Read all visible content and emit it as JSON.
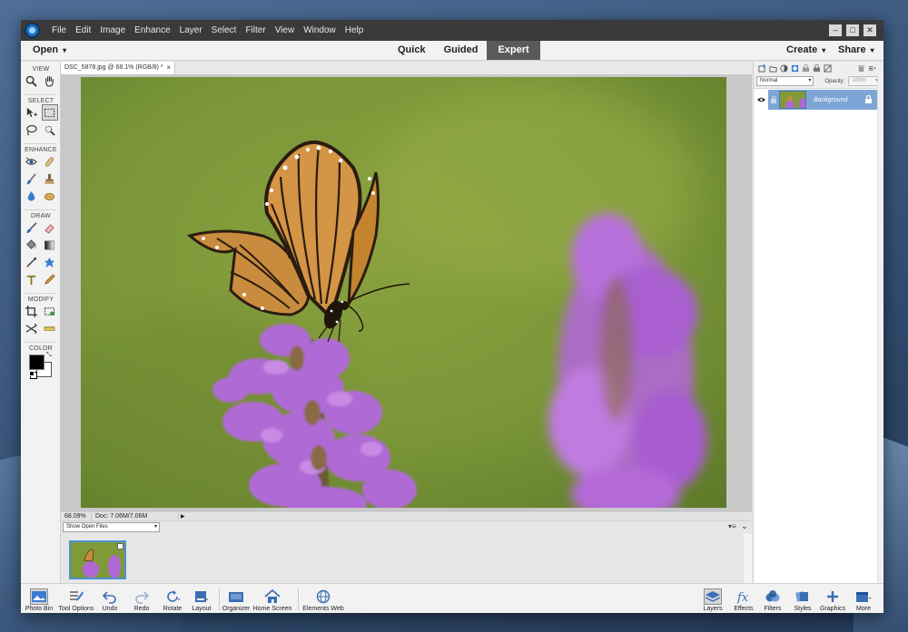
{
  "menubar": {
    "items": [
      "File",
      "Edit",
      "Image",
      "Enhance",
      "Layer",
      "Select",
      "Filter",
      "View",
      "Window",
      "Help"
    ],
    "window_controls": [
      "–",
      "□",
      "✕"
    ]
  },
  "modebar": {
    "open": "Open",
    "tabs": [
      "Quick",
      "Guided",
      "Expert"
    ],
    "active_tab": "Expert",
    "create": "Create",
    "share": "Share"
  },
  "toolbox": {
    "sections": {
      "view": "VIEW",
      "select": "SELECT",
      "enhance": "ENHANCE",
      "draw": "DRAW",
      "modify": "MODIFY",
      "color": "COLOR"
    },
    "foreground_color": "#000000",
    "background_color": "#ffffff"
  },
  "document": {
    "tab_title": "DSC_5878.jpg @ 68.1% (RGB/8) *",
    "close": "×",
    "zoom": "68.09%",
    "doc_info": "Doc: 7.06M/7.06M"
  },
  "layers_panel": {
    "blend_mode": "Normal",
    "opacity_label": "Opacity:",
    "opacity_value": "100%",
    "layer_name": "Background"
  },
  "photo_bin": {
    "show_select": "Show Open Files"
  },
  "taskbar": {
    "photo_bin": "Photo Bin",
    "tool_options": "Tool Options",
    "undo": "Undo",
    "redo": "Redo",
    "rotate": "Rotate",
    "layout": "Layout",
    "organizer": "Organizer",
    "home_screen": "Home Screen",
    "elements_web": "Elements Web",
    "layers": "Layers",
    "effects": "Effects",
    "filters": "Filters",
    "styles": "Styles",
    "graphics": "Graphics",
    "more": "More"
  }
}
